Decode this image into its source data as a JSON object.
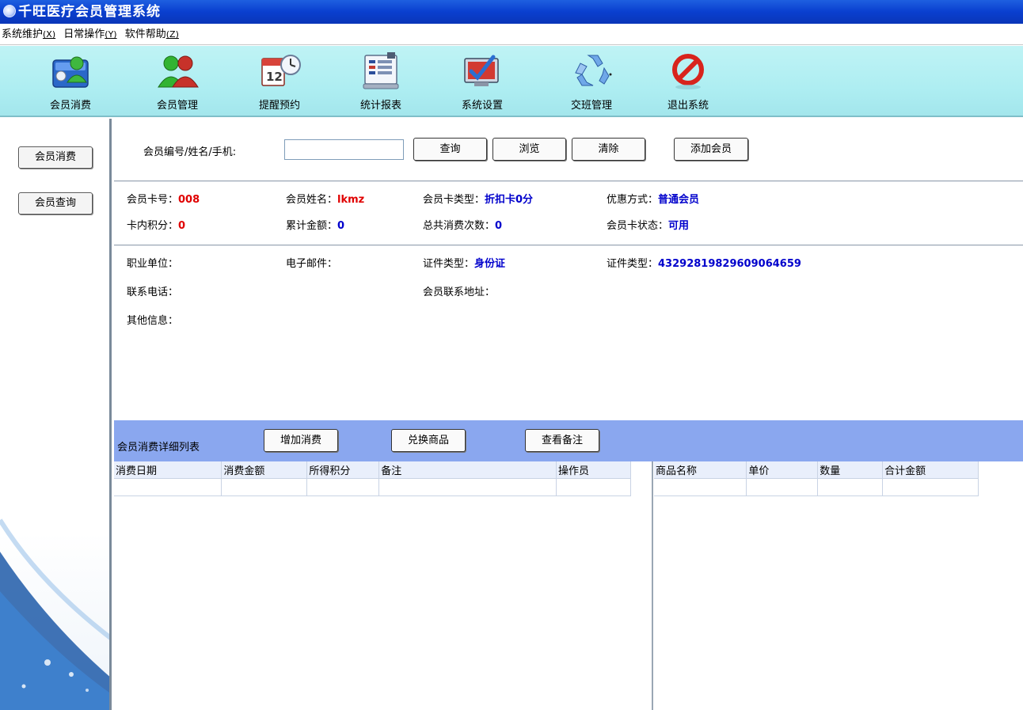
{
  "window": {
    "title": "千旺医疗会员管理系统"
  },
  "menu": [
    {
      "label": "系统维护",
      "key": "(X)"
    },
    {
      "label": "日常操作",
      "key": "(Y)"
    },
    {
      "label": "软件帮助",
      "key": "(Z)"
    }
  ],
  "toolbar": [
    {
      "label": "会员消费",
      "icon": "member-consume-icon"
    },
    {
      "label": "会员管理",
      "icon": "member-manage-icon"
    },
    {
      "label": "提醒预约",
      "icon": "calendar-clock-icon"
    },
    {
      "label": "统计报表",
      "icon": "report-icon"
    },
    {
      "label": "系统设置",
      "icon": "settings-icon"
    },
    {
      "label": "交班管理",
      "icon": "recycle-icon"
    },
    {
      "label": "退出系统",
      "icon": "exit-icon"
    }
  ],
  "sidebar": {
    "buttons": [
      {
        "label": "会员消费"
      },
      {
        "label": "会员查询"
      }
    ]
  },
  "search": {
    "label": "会员编号/姓名/手机:",
    "value": "",
    "buttons": {
      "query": "查询",
      "browse": "浏览",
      "clear": "清除",
      "add": "添加会员"
    }
  },
  "member": {
    "card_no_label": "会员卡号：",
    "card_no": "008",
    "name_label": "会员姓名：",
    "name": "lkmz",
    "card_type_label": "会员卡类型：",
    "card_type": "折扣卡0分",
    "discount_label": "优惠方式：",
    "discount": "普通会员",
    "points_label": "卡内积分：",
    "points": "0",
    "total_label": "累计金额：",
    "total": "0",
    "count_label": "总共消费次数：",
    "count": "0",
    "status_label": "会员卡状态：",
    "status": "可用"
  },
  "details": {
    "org_label": "职业单位：",
    "email_label": "电子邮件：",
    "id_type_label": "证件类型：",
    "id_type": "身份证",
    "id_no_label": "证件类型：",
    "id_no": "432928198296090646​59",
    "phone_label": "联系电话：",
    "address_label": "会员联系地址：",
    "other_label": "其他信息："
  },
  "consume": {
    "title": "会员消费详细列表",
    "buttons": {
      "add": "增加消费",
      "exchange": "兑换商品",
      "remark": "查看备注"
    },
    "columns": [
      "消费日期",
      "消费金额",
      "所得积分",
      "备注",
      "操作员"
    ],
    "goods_columns": [
      "商品名称",
      "单价",
      "数量",
      "合计金额"
    ]
  },
  "colors": {
    "titlebar": "#0a3fcf",
    "toolbar": "#aeeef2",
    "band": "#8aa7ef",
    "red": "#e00000",
    "blue": "#0000cc"
  }
}
